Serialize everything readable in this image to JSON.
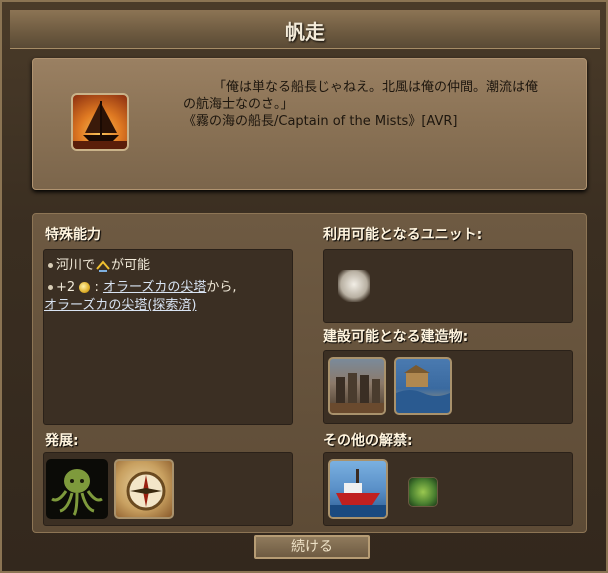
{
  "window": {
    "title": "帆走"
  },
  "tech_icon": "sailboat-icon",
  "quote": {
    "line1": "「俺は単なる船長じゃねえ。北風は俺の仲間。潮流は俺",
    "line2": "の航海士なのさ。」",
    "line3": "《霧の海の船長/Captain of the Mists》[AVR]"
  },
  "special": {
    "title": "特殊能力",
    "ability1_text": "河川で",
    "ability1_suffix": "が可能",
    "ability1_icon": "trade-route-icon",
    "ability2_prefix": "+2",
    "ability2_sep": ":",
    "ability2_link1": "オラーズカの尖塔",
    "ability2_mid": "から,",
    "ability2_link2": "オラーズカの尖塔(探索済)"
  },
  "units": {
    "title": "利用可能となるユニット:"
  },
  "buildings": {
    "title": "建設可能となる建造物:"
  },
  "leads_to": {
    "title": "発展:"
  },
  "other": {
    "title": "その他の解禁:"
  },
  "continue_label": "続ける"
}
